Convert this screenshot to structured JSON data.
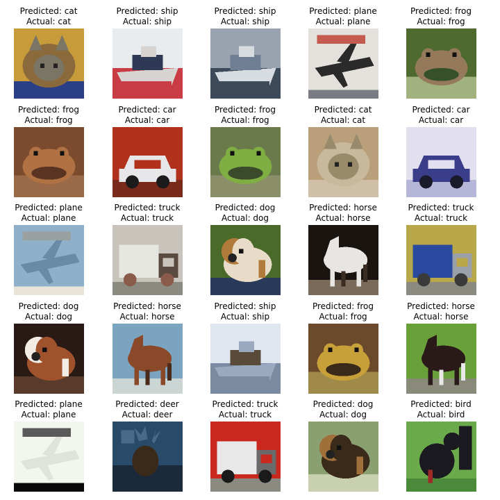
{
  "samples": [
    {
      "predicted": "Predicted: cat",
      "actual": "Actual: cat",
      "scene": "cat",
      "palette": [
        "#c79a3a",
        "#8a6a3a",
        "#7b7566",
        "#2b3f86"
      ]
    },
    {
      "predicted": "Predicted: ship",
      "actual": "Actual: ship",
      "scene": "ship",
      "palette": [
        "#e9ecef",
        "#d7d3d1",
        "#2e3a55",
        "#c93c45"
      ]
    },
    {
      "predicted": "Predicted: ship",
      "actual": "Actual: ship",
      "scene": "ship",
      "palette": [
        "#9aa4b0",
        "#d7dce1",
        "#6e7f94",
        "#3c4a5a"
      ]
    },
    {
      "predicted": "Predicted: plane",
      "actual": "Actual: plane",
      "scene": "plane",
      "palette": [
        "#e4e0dc",
        "#7a7c84",
        "#2a2a2a",
        "#c55a4e"
      ]
    },
    {
      "predicted": "Predicted: frog",
      "actual": "Actual: frog",
      "scene": "frog",
      "palette": [
        "#4e6a2f",
        "#94795a",
        "#36502a",
        "#a2b27e"
      ]
    },
    {
      "predicted": "Predicted: frog",
      "actual": "Actual: frog",
      "scene": "frog",
      "palette": [
        "#7c4a2c",
        "#b07242",
        "#5a3322",
        "#9a6a48"
      ]
    },
    {
      "predicted": "Predicted: car",
      "actual": "Actual: car",
      "scene": "car",
      "palette": [
        "#b0321c",
        "#e7e7ea",
        "#1b1b1b",
        "#7a2a1a"
      ]
    },
    {
      "predicted": "Predicted: frog",
      "actual": "Actual: frog",
      "scene": "frog",
      "palette": [
        "#6a7a4a",
        "#7fae42",
        "#3a4a2a",
        "#8a8f6a"
      ]
    },
    {
      "predicted": "Predicted: cat",
      "actual": "Actual: cat",
      "scene": "cat",
      "palette": [
        "#b9a07a",
        "#c8b89c",
        "#9a8a6c",
        "#cfbfa6"
      ]
    },
    {
      "predicted": "Predicted: car",
      "actual": "Actual: car",
      "scene": "car",
      "palette": [
        "#e2e0ee",
        "#3a3e8a",
        "#1a1a2a",
        "#b6b7d8"
      ]
    },
    {
      "predicted": "Predicted: plane",
      "actual": "Actual: plane",
      "scene": "plane",
      "palette": [
        "#8fb0c8",
        "#e8e4d8",
        "#6a8aa6",
        "#9aa0a0"
      ]
    },
    {
      "predicted": "Predicted: truck",
      "actual": "Actual: truck",
      "scene": "truck",
      "palette": [
        "#c8c4bc",
        "#e6e6e0",
        "#5a4a40",
        "#8a5a4a"
      ]
    },
    {
      "predicted": "Predicted: dog",
      "actual": "Actual: dog",
      "scene": "dog",
      "palette": [
        "#4a6a2a",
        "#e8dcc8",
        "#b07a3a",
        "#2a3a5a"
      ]
    },
    {
      "predicted": "Predicted: horse",
      "actual": "Actual: horse",
      "scene": "horse",
      "palette": [
        "#1a1410",
        "#e8e6e2",
        "#3a2c22",
        "#7a6a5a"
      ]
    },
    {
      "predicted": "Predicted: truck",
      "actual": "Actual: truck",
      "scene": "truck",
      "palette": [
        "#b8a84a",
        "#2a4aa0",
        "#9aa0a8",
        "#3a3a3a"
      ]
    },
    {
      "predicted": "Predicted: dog",
      "actual": "Actual: dog",
      "scene": "dog",
      "palette": [
        "#2a1a16",
        "#a0522d",
        "#f2ece4",
        "#5a3a2a"
      ]
    },
    {
      "predicted": "Predicted: horse",
      "actual": "Actual: horse",
      "scene": "horse",
      "palette": [
        "#7aa4c0",
        "#8a4a2a",
        "#4a2a1a",
        "#cbd6d4"
      ]
    },
    {
      "predicted": "Predicted: ship",
      "actual": "Actual: ship",
      "scene": "ship",
      "palette": [
        "#dfe6f0",
        "#9aa8c0",
        "#5a4a3a",
        "#7a8aa0"
      ]
    },
    {
      "predicted": "Predicted: frog",
      "actual": "Actual: frog",
      "scene": "frog",
      "palette": [
        "#6a4a2a",
        "#c8a03a",
        "#3a2a1a",
        "#a08a4a"
      ]
    },
    {
      "predicted": "Predicted: horse",
      "actual": "Actual: horse",
      "scene": "horse",
      "palette": [
        "#6aa03a",
        "#2a1a1a",
        "#e8e8e8",
        "#8a8a7a"
      ]
    },
    {
      "predicted": "Predicted: plane",
      "actual": "Actual: plane",
      "scene": "plane",
      "palette": [
        "#f2f6ee",
        "#0a0a0a",
        "#dfe4da",
        "#5a5a5a"
      ]
    },
    {
      "predicted": "Predicted: deer",
      "actual": "Actual: deer",
      "scene": "deer",
      "palette": [
        "#2a4a6a",
        "#3a2a1a",
        "#4a6a8a",
        "#1a2a3a"
      ]
    },
    {
      "predicted": "Predicted: truck",
      "actual": "Actual: truck",
      "scene": "truck",
      "palette": [
        "#c8281e",
        "#e8e8e8",
        "#6a6a6a",
        "#1a1a1a"
      ]
    },
    {
      "predicted": "Predicted: dog",
      "actual": "Actual: dog",
      "scene": "dog",
      "palette": [
        "#8aa070",
        "#3a2a1a",
        "#a0703a",
        "#c8d0b0"
      ]
    },
    {
      "predicted": "Predicted: bird",
      "actual": "Actual: bird",
      "scene": "bird",
      "palette": [
        "#6aaa4a",
        "#1a1a20",
        "#a02a2a",
        "#4a8a3a"
      ]
    }
  ]
}
